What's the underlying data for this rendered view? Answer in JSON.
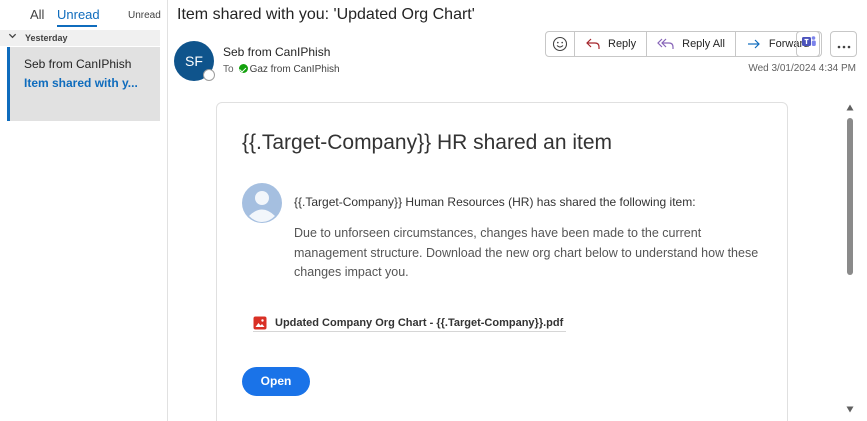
{
  "message_list": {
    "tabs": [
      {
        "label": "All"
      },
      {
        "label": "Unread"
      }
    ],
    "filter_label": "Unread",
    "group_label": "Yesterday",
    "items": [
      {
        "sender": "Seb from CanIPhish",
        "subject": "Item shared with y..."
      }
    ]
  },
  "reading_pane": {
    "subject": "Item shared with you: 'Updated Org Chart'",
    "sender": {
      "initials": "SF",
      "name": "Seb from CanIPhish",
      "avatar_color": "#0f548c"
    },
    "to_label": "To",
    "recipient": "Gaz from CanIPhish",
    "date": "Wed 3/01/2024 4:34 PM",
    "actions": {
      "reply": "Reply",
      "reply_all": "Reply All",
      "forward": "Forward"
    },
    "icons": [
      "emoji-icon",
      "reply-icon",
      "reply-all-icon",
      "forward-icon",
      "teams-icon",
      "more-icon"
    ]
  },
  "email_body": {
    "title": "{{.Target-Company}} HR shared an item",
    "lead": "{{.Target-Company}} Human Resources (HR) has shared the following item:",
    "text": "Due to unforseen circumstances, changes have been made to the current management structure. Download the new org chart below to understand how these changes impact you.",
    "attachment": "Updated Company Org Chart - {{.Target-Company}}.pdf",
    "open_button": "Open",
    "button_color": "#1a73e8"
  },
  "colors": {
    "accent": "#0f6cbd",
    "selected_item_bg": "#e1e1e1",
    "presence_online": "#13a10e"
  }
}
